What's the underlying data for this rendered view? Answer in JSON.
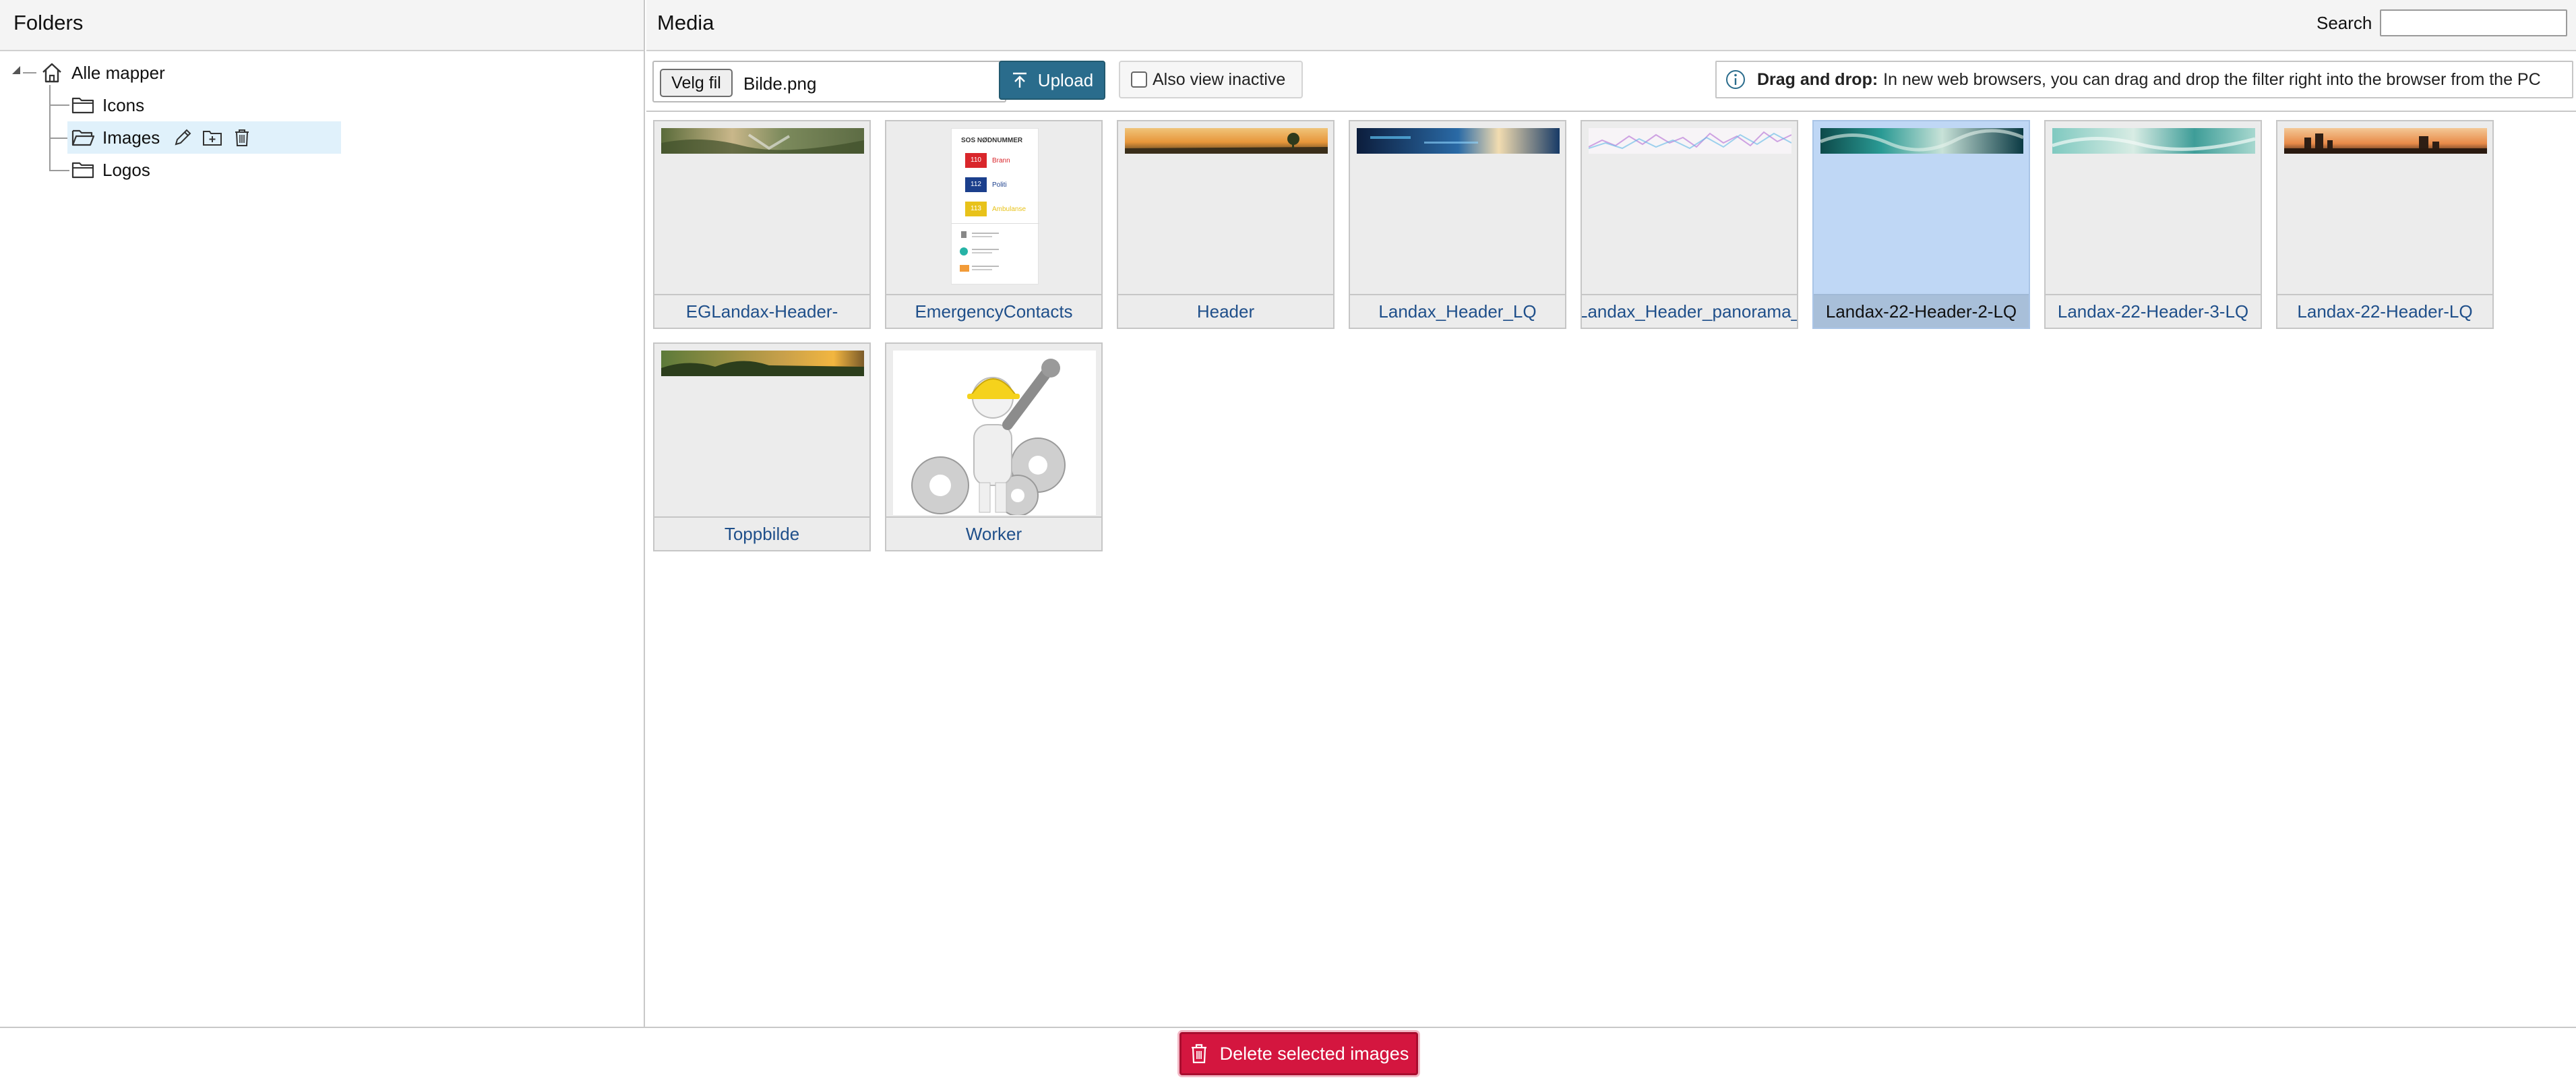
{
  "folders_panel": {
    "title": "Folders",
    "root": {
      "label": "Alle mapper"
    },
    "items": [
      {
        "label": "Icons",
        "selected": false
      },
      {
        "label": "Images",
        "selected": true
      },
      {
        "label": "Logos",
        "selected": false
      }
    ]
  },
  "media_panel": {
    "title": "Media",
    "search": {
      "label": "Search",
      "value": "",
      "placeholder": ""
    }
  },
  "toolbar": {
    "file_button": "Velg fil",
    "file_name": "Bilde.png",
    "upload_label": "Upload",
    "inactive_label": "Also view inactive",
    "inactive_checked": false,
    "info_bold": "Drag and drop:",
    "info_text": "In new web browsers, you can drag and drop the filter right into the browser from the PC"
  },
  "media_items": [
    {
      "caption": "EGLandax-Header-",
      "selected": false
    },
    {
      "caption": "EmergencyContacts",
      "selected": false
    },
    {
      "caption": "Header",
      "selected": false
    },
    {
      "caption": "Landax_Header_LQ",
      "selected": false
    },
    {
      "caption": "Landax_Header_panorama_",
      "selected": false
    },
    {
      "caption": "Landax-22-Header-2-LQ",
      "selected": true
    },
    {
      "caption": "Landax-22-Header-3-LQ",
      "selected": false
    },
    {
      "caption": "Landax-22-Header-LQ",
      "selected": false
    },
    {
      "caption": "Toppbilde",
      "selected": false
    },
    {
      "caption": "Worker",
      "selected": false
    }
  ],
  "emergency_doc": {
    "title": "SOS NØDNUMMER",
    "rows": [
      {
        "number": "110",
        "label": "Brann"
      },
      {
        "number": "112",
        "label": "Politi"
      },
      {
        "number": "113",
        "label": "Ambulanse"
      }
    ]
  },
  "footer": {
    "delete_label": "Delete selected images"
  },
  "colors": {
    "upload": "#2a6c8c",
    "delete": "#d4163f",
    "selected_tile": "#bfd7f5",
    "selected_folder": "#e0f1fb",
    "caption_link": "#1f4f8a"
  },
  "icons": {
    "root": "home-icon",
    "folder": "folder-icon",
    "edit": "pencil-icon",
    "add_folder": "folder-add-icon",
    "delete_folder": "trash-icon",
    "upload": "upload-arrow-icon",
    "info": "info-circle-icon",
    "delete": "trash-icon"
  }
}
